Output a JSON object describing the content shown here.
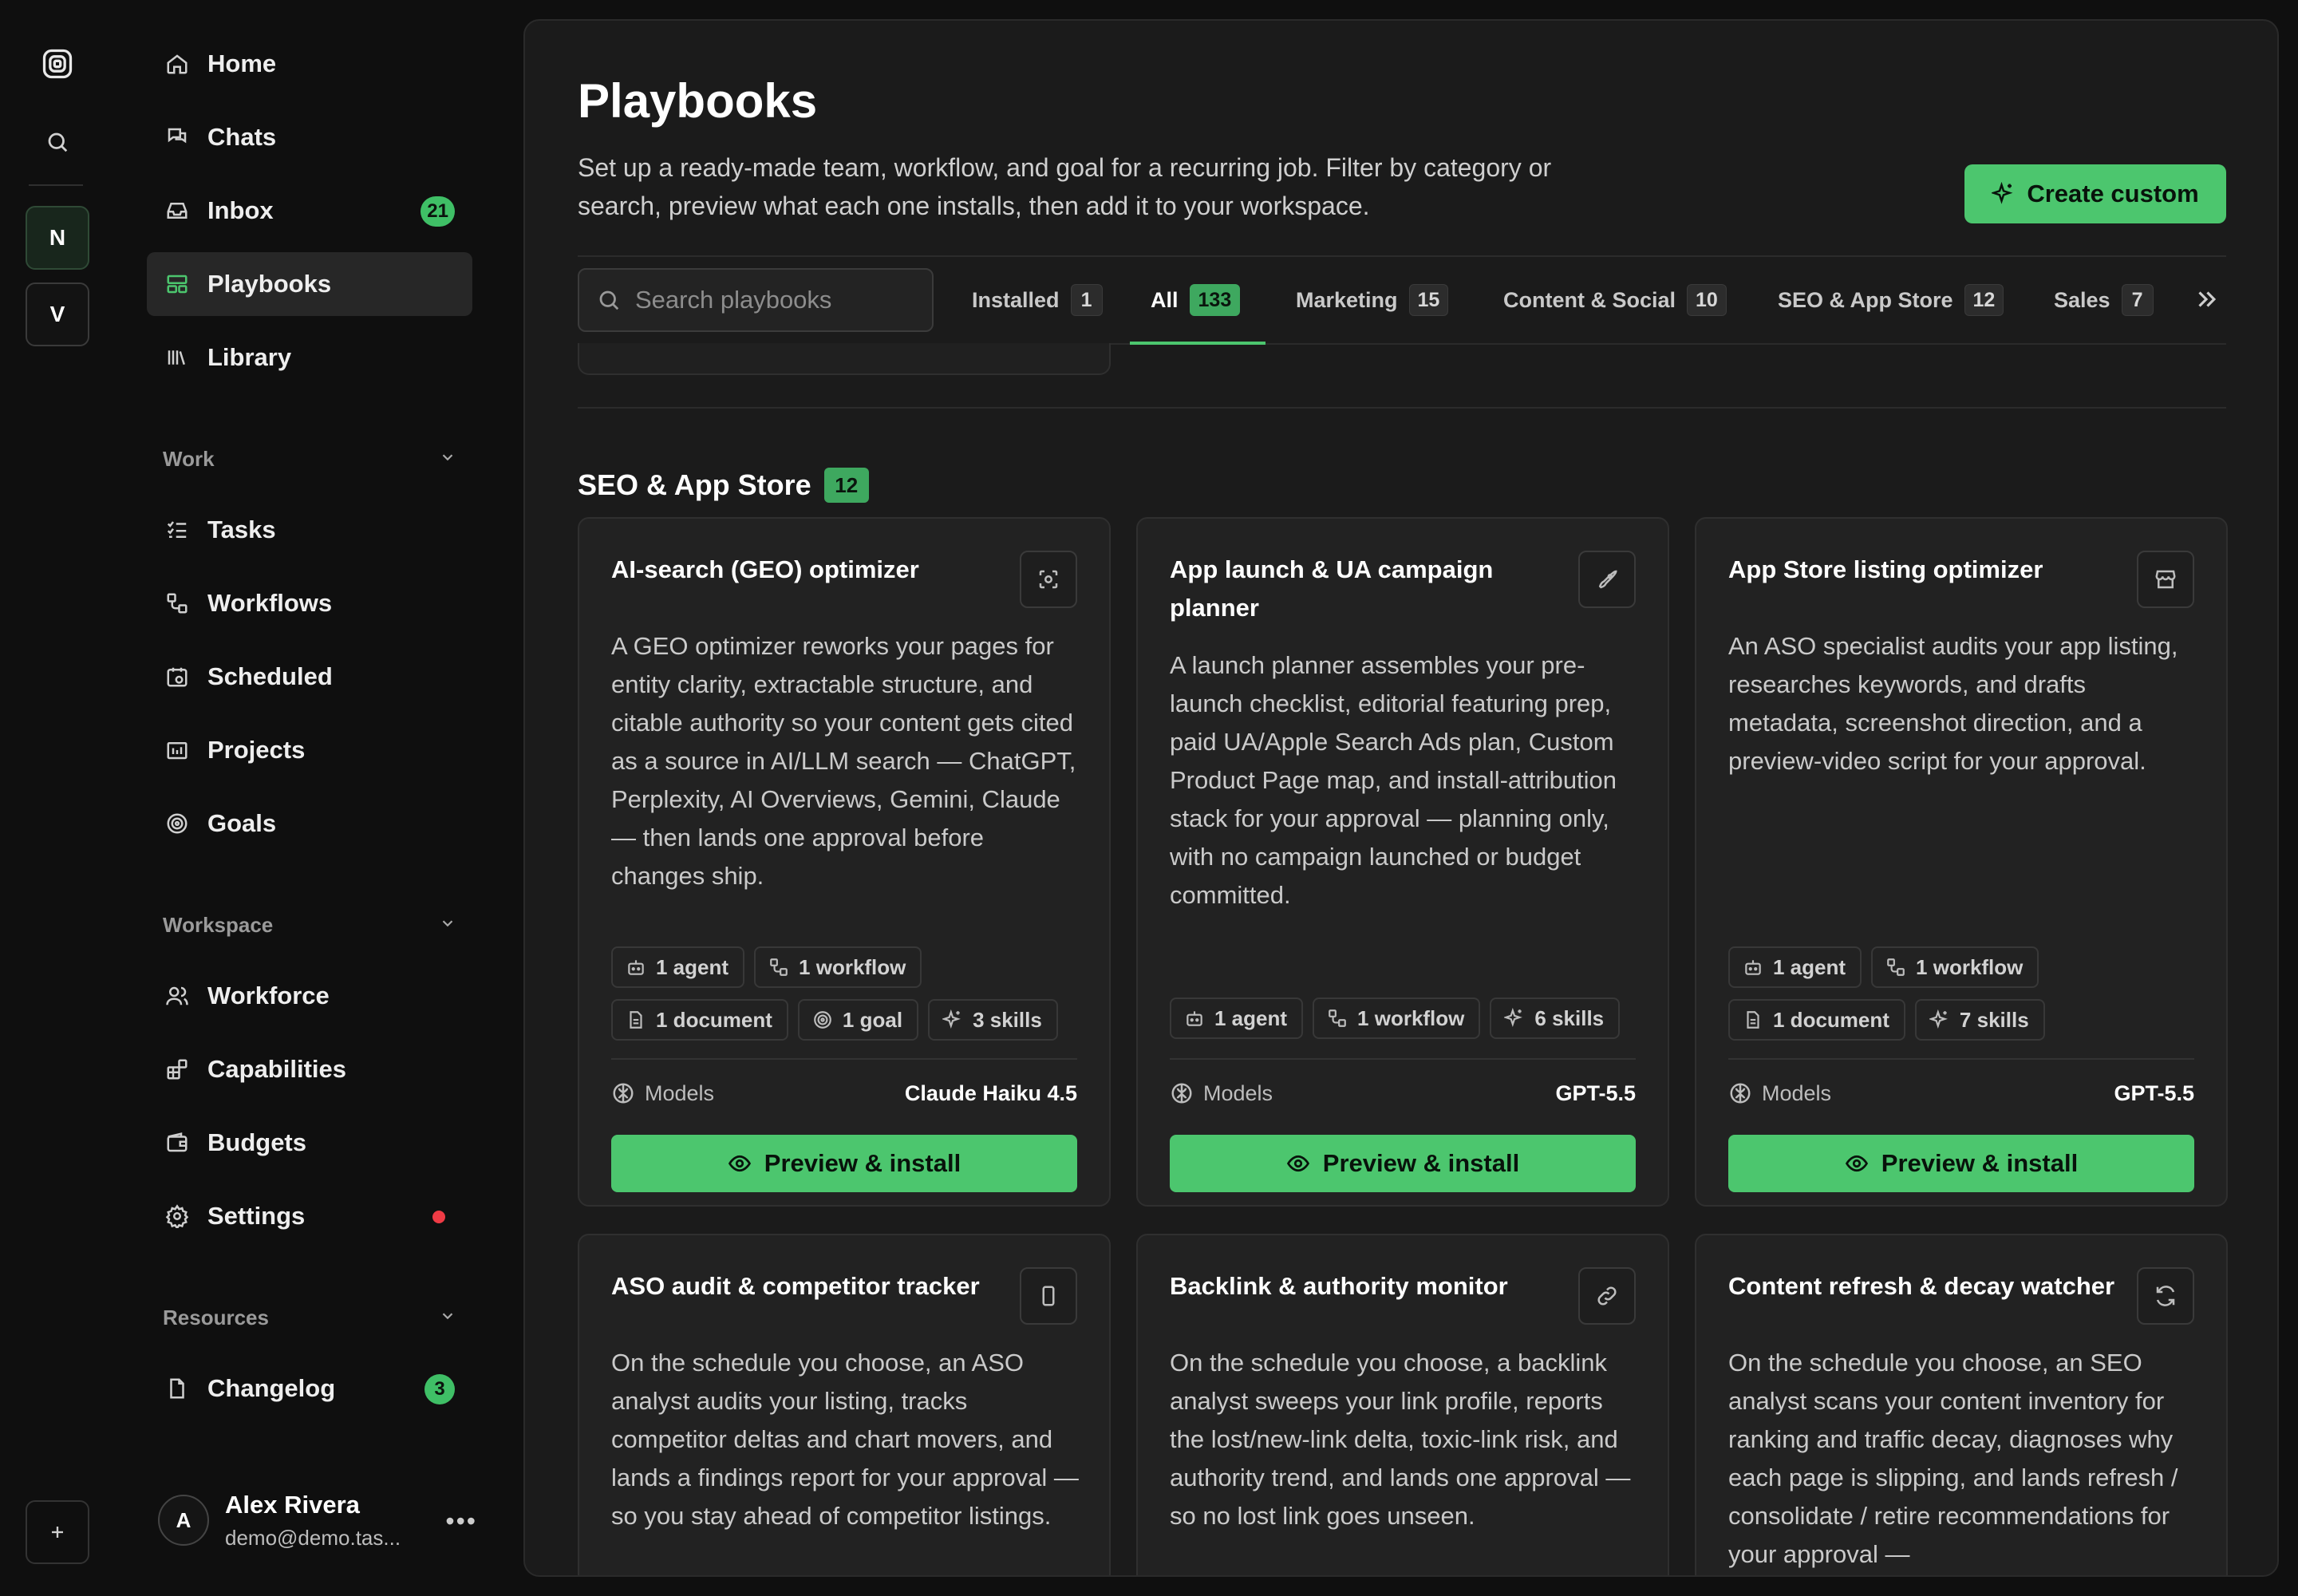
{
  "sidebar": {
    "nav": [
      {
        "label": "Home",
        "icon": "home-icon"
      },
      {
        "label": "Chats",
        "icon": "chats-icon"
      },
      {
        "label": "Inbox",
        "icon": "inbox-icon",
        "badge": "21"
      },
      {
        "label": "Playbooks",
        "icon": "playbooks-icon",
        "active": true
      },
      {
        "label": "Library",
        "icon": "library-icon"
      }
    ],
    "work_header": "Work",
    "work": [
      {
        "label": "Tasks",
        "icon": "tasks-icon"
      },
      {
        "label": "Workflows",
        "icon": "workflows-icon"
      },
      {
        "label": "Scheduled",
        "icon": "calendar-icon"
      },
      {
        "label": "Projects",
        "icon": "projects-icon"
      },
      {
        "label": "Goals",
        "icon": "target-icon"
      }
    ],
    "workspace_header": "Workspace",
    "workspace": [
      {
        "label": "Workforce",
        "icon": "users-icon"
      },
      {
        "label": "Capabilities",
        "icon": "capabilities-icon"
      },
      {
        "label": "Budgets",
        "icon": "wallet-icon"
      },
      {
        "label": "Settings",
        "icon": "gear-icon",
        "dot_color": "#ef3b45"
      }
    ],
    "resources_header": "Resources",
    "resources": [
      {
        "label": "Changelog",
        "icon": "document-icon",
        "badge": "3"
      }
    ],
    "user": {
      "initial": "A",
      "name": "Alex Rivera",
      "email": "demo@demo.tas..."
    }
  },
  "rail": {
    "workspaces": [
      "N",
      "V"
    ]
  },
  "header": {
    "title": "Playbooks",
    "description": "Set up a ready-made team, workflow, and goal for a recurring job. Filter by category or search, preview what each one installs, then add it to your workspace.",
    "create_label": "Create custom"
  },
  "search": {
    "placeholder": "Search playbooks",
    "value": ""
  },
  "tabs": [
    {
      "label": "Installed",
      "count": "1"
    },
    {
      "label": "All",
      "count": "133",
      "active": true
    },
    {
      "label": "Marketing",
      "count": "15"
    },
    {
      "label": "Content & Social",
      "count": "10"
    },
    {
      "label": "SEO & App Store",
      "count": "12"
    },
    {
      "label": "Sales",
      "count": "7"
    }
  ],
  "section": {
    "title": "SEO & App Store",
    "count": "12"
  },
  "cards": [
    {
      "title": "AI-search (GEO) optimizer",
      "icon": "scan-icon",
      "description": "A GEO optimizer reworks your pages for entity clarity, extractable structure, and citable authority so your content gets cited as a source in AI/LLM search — ChatGPT, Perplexity, AI Overviews, Gemini, Claude — then lands one approval before changes ship.",
      "chips": [
        {
          "label": "1 agent",
          "icon": "bot-icon"
        },
        {
          "label": "1 workflow",
          "icon": "workflow-icon"
        },
        {
          "label": "1 document",
          "icon": "document-icon"
        },
        {
          "label": "1 goal",
          "icon": "target-icon"
        },
        {
          "label": "3 skills",
          "icon": "sparkles-icon"
        }
      ],
      "models_label": "Models",
      "model": "Claude Haiku 4.5",
      "button": "Preview & install"
    },
    {
      "title": "App launch & UA campaign planner",
      "icon": "rocket-icon",
      "description": "A launch planner assembles your pre-launch checklist, editorial featuring prep, paid UA/Apple Search Ads plan, Custom Product Page map, and install-attribution stack for your approval — planning only, with no campaign launched or budget committed.",
      "chips": [
        {
          "label": "1 agent",
          "icon": "bot-icon"
        },
        {
          "label": "1 workflow",
          "icon": "workflow-icon"
        },
        {
          "label": "6 skills",
          "icon": "sparkles-icon"
        }
      ],
      "models_label": "Models",
      "model": "GPT-5.5",
      "button": "Preview & install"
    },
    {
      "title": "App Store listing optimizer",
      "icon": "store-icon",
      "description": "An ASO specialist audits your app listing, researches keywords, and drafts metadata, screenshot direction, and a preview-video script for your approval.",
      "chips": [
        {
          "label": "1 agent",
          "icon": "bot-icon"
        },
        {
          "label": "1 workflow",
          "icon": "workflow-icon"
        },
        {
          "label": "1 document",
          "icon": "document-icon"
        },
        {
          "label": "7 skills",
          "icon": "sparkles-icon"
        }
      ],
      "models_label": "Models",
      "model": "GPT-5.5",
      "button": "Preview & install"
    },
    {
      "title": "ASO audit & competitor tracker",
      "icon": "phone-icon",
      "description": "On the schedule you choose, an ASO analyst audits your listing, tracks competitor deltas and chart movers, and lands a findings report for your approval — so you stay ahead of competitor listings."
    },
    {
      "title": "Backlink & authority monitor",
      "icon": "link-icon",
      "description": "On the schedule you choose, a backlink analyst sweeps your link profile, reports the lost/new-link delta, toxic-link risk, and authority trend, and lands one approval — so no lost link goes unseen."
    },
    {
      "title": "Content refresh & decay watcher",
      "icon": "refresh-icon",
      "description": "On the schedule you choose, an SEO analyst scans your content inventory for ranking and traffic decay, diagnoses why each page is slipping, and lands refresh / consolidate / retire recommendations for your approval —"
    }
  ],
  "colors": {
    "accent": "#4cc66e",
    "background": "#0f0f0f",
    "panel": "#1b1b1b",
    "card": "#222222",
    "alert_dot": "#ef3b45"
  }
}
